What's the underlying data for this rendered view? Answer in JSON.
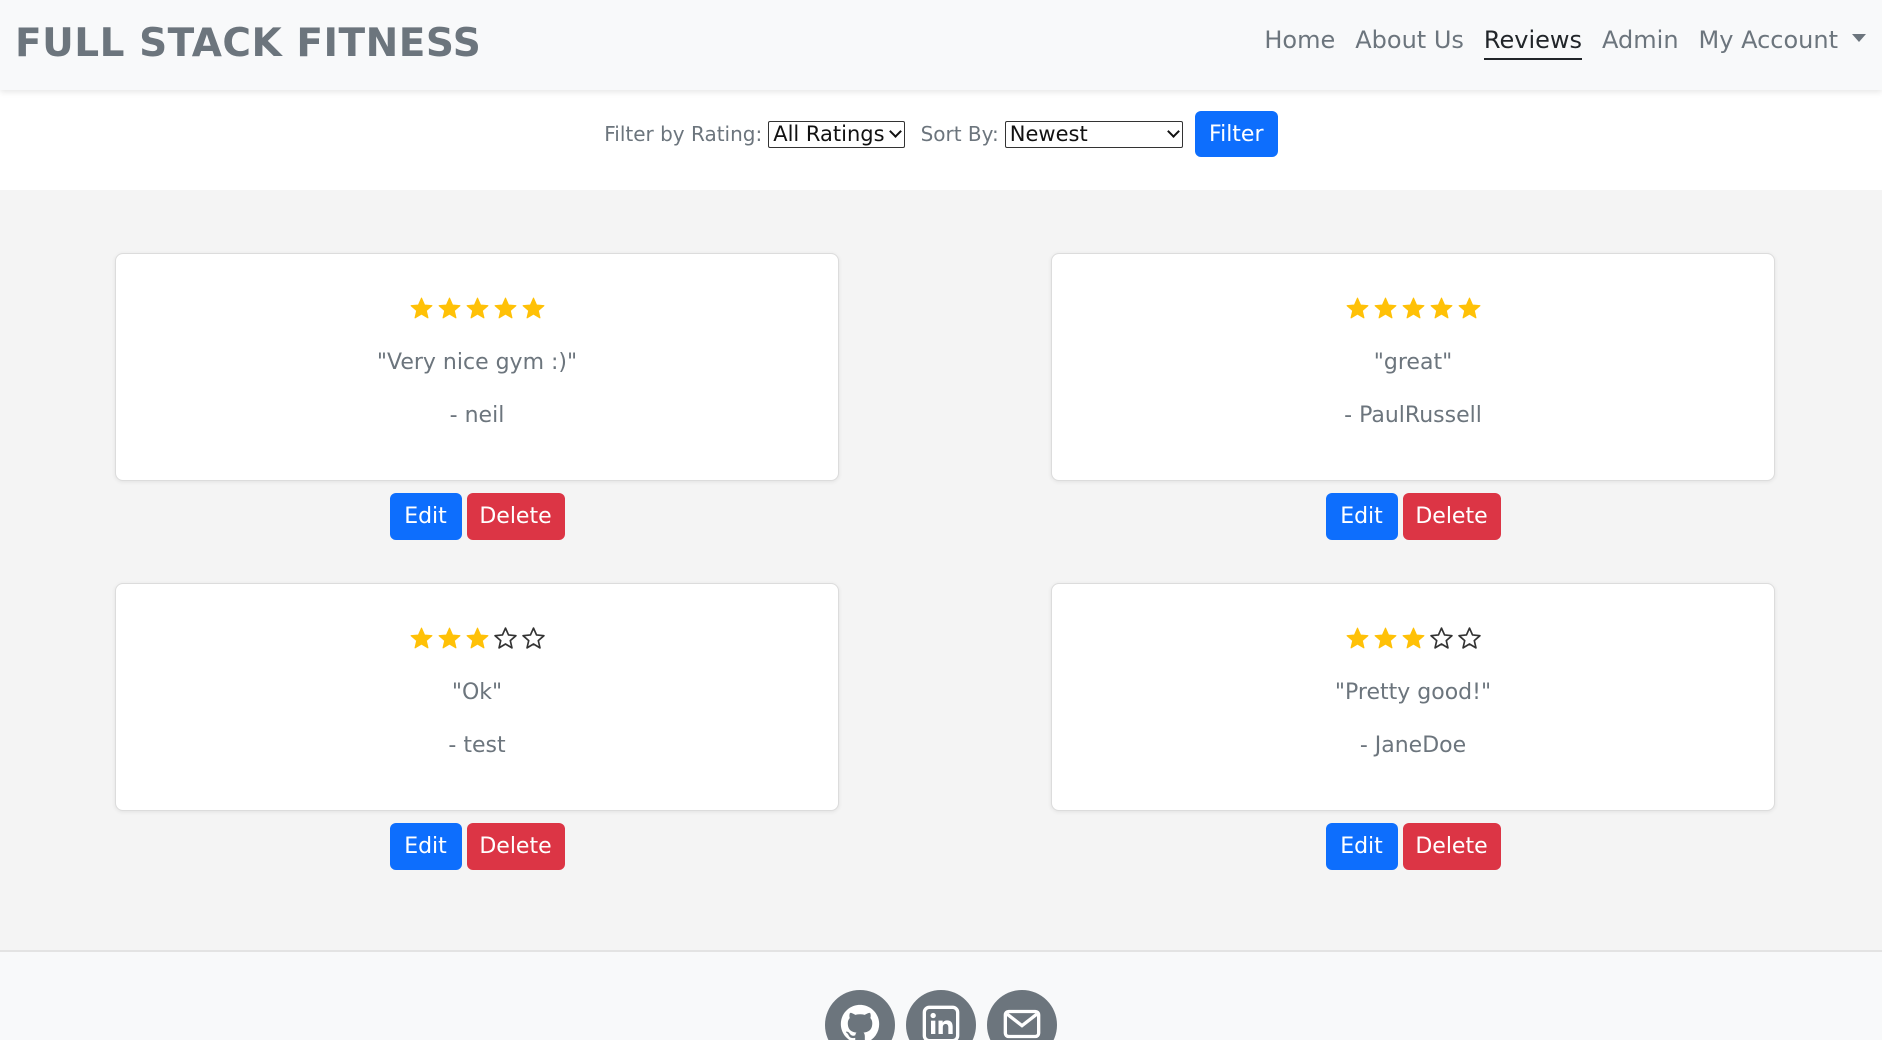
{
  "navbar": {
    "brand": "FULL STACK FITNESS",
    "links": [
      {
        "label": "Home"
      },
      {
        "label": "About Us"
      },
      {
        "label": "Reviews",
        "active": true
      },
      {
        "label": "Admin"
      },
      {
        "label": "My Account"
      }
    ]
  },
  "filters": {
    "rating_label": "Filter by Rating:",
    "rating_value": "All Ratings",
    "sort_label": "Sort By:",
    "sort_value": "Newest",
    "filter_button": "Filter"
  },
  "reviews": [
    {
      "rating": 5,
      "max_rating": 5,
      "comment": "\"Very nice gym :)\"",
      "author": "- neil"
    },
    {
      "rating": 5,
      "max_rating": 5,
      "comment": "\"great\"",
      "author": "- PaulRussell"
    },
    {
      "rating": 3,
      "max_rating": 5,
      "comment": "\"Ok\"",
      "author": "- test"
    },
    {
      "rating": 3,
      "max_rating": 5,
      "comment": "\"Pretty good!\"",
      "author": "- JaneDoe"
    }
  ],
  "review_actions": {
    "edit_label": "Edit",
    "delete_label": "Delete"
  },
  "footer": {
    "social_icons": [
      "github-icon",
      "linkedin-icon",
      "email-icon"
    ]
  },
  "colors": {
    "primary": "#0d6efd",
    "danger": "#dc3545",
    "star": "#ffc107",
    "muted_text": "#6c757d"
  }
}
